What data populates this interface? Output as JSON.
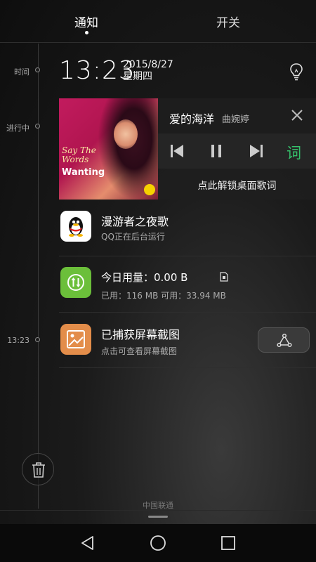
{
  "tabs": {
    "notifications": "通知",
    "toggles": "开关"
  },
  "timeline": {
    "time_label": "时间",
    "ongoing_label": "进行中",
    "screenshot_time": "13:23"
  },
  "clock": {
    "time": "13:23",
    "date": "2015/8/27",
    "weekday": "星期四"
  },
  "music": {
    "song": "爱的海洋",
    "artist": "曲婉婷",
    "album_art_title": "Say The Words",
    "album_art_artist": "Wanting",
    "lyrics_button": "词",
    "unlock_lyrics": "点此解锁桌面歌词"
  },
  "qq": {
    "title": "漫游者之夜歌",
    "subtitle": "QQ正在后台运行"
  },
  "data_usage": {
    "title": "今日用量：0.00 B",
    "subtitle": "已用：116 MB 可用：33.94 MB"
  },
  "screenshot": {
    "title": "已捕获屏幕截图",
    "subtitle": "点击可查看屏幕截图"
  },
  "carrier": "中国联通",
  "colors": {
    "lyrics_green": "#35c06a",
    "data_icon_green": "#6bbf3a",
    "screenshot_icon_orange": "#e38d4a"
  },
  "icons": [
    "bulb-icon",
    "close-icon",
    "prev-icon",
    "pause-icon",
    "next-icon",
    "qq-penguin-icon",
    "data-transfer-icon",
    "sim-icon",
    "image-icon",
    "share-icon",
    "trash-icon",
    "back-icon",
    "home-icon",
    "recents-icon"
  ]
}
